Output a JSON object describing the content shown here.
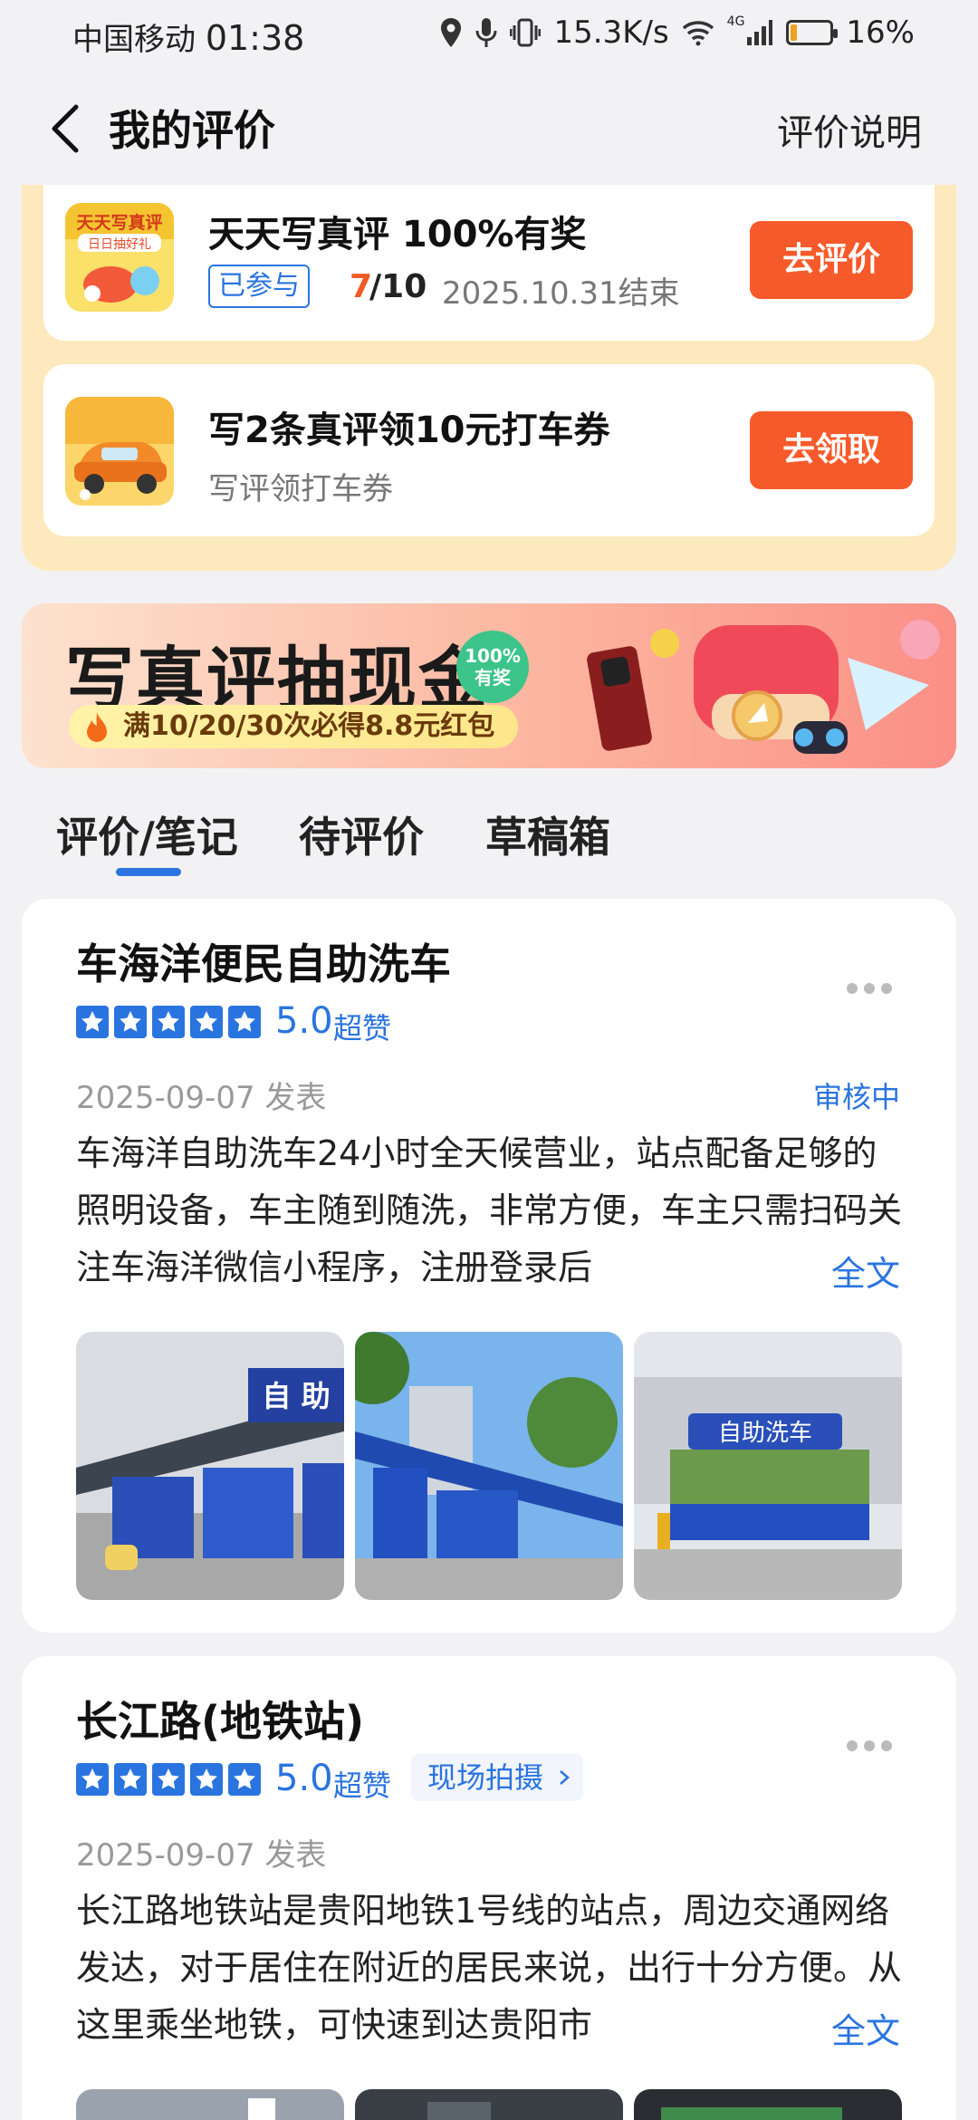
{
  "status_bar": {
    "carrier": "中国移动",
    "time": "01:38",
    "net_speed": "15.3K/s",
    "network": "4G",
    "battery": "16%",
    "battery_level": 0.16,
    "icons": [
      "location-icon",
      "mic-icon",
      "vibrate-icon",
      "wifi-icon",
      "signal-icon",
      "battery-icon"
    ]
  },
  "header": {
    "title": "我的评价",
    "help_link": "评价说明"
  },
  "promos": [
    {
      "title": "天天写真评 100%有奖",
      "badge": "已参与",
      "progress_done": "7",
      "progress_total": "/10",
      "deadline": "2025.10.31结束",
      "button": "去评价"
    },
    {
      "title": "写2条真评领10元打车券",
      "subtitle": "写评领打车券",
      "button": "去领取"
    }
  ],
  "banner": {
    "title": "写真评抽现金",
    "badge": "100% 有奖",
    "subtitle": "满10/20/30次必得8.8元红包"
  },
  "tabs": [
    {
      "label": "评价/笔记",
      "active": true
    },
    {
      "label": "待评价",
      "active": false
    },
    {
      "label": "草稿箱",
      "active": false
    }
  ],
  "reviews": [
    {
      "title": "车海洋便民自助洗车",
      "rating": "5.0",
      "rating_word": "超赞",
      "stars": 5,
      "date": "2025-09-07 发表",
      "status": "审核中",
      "body": "车海洋自助洗车24小时全天候营业，站点配备足够的照明设备，车主随到随洗，非常方便，车主只需扫码关注车海洋微信小程序，注册登录后",
      "full_text": "全文",
      "photos": [
        "photo-carwash-canopy",
        "photo-carwash-tower",
        "photo-carwash-gate"
      ]
    },
    {
      "title": "长江路(地铁站)",
      "rating": "5.0",
      "rating_word": "超赞",
      "stars": 5,
      "tag": "现场拍摄",
      "date": "2025-09-07 发表",
      "body": "长江路地铁站是贵阳地铁1号线的站点，周边交通网络发达，对于居住在附近的居民来说，出行十分方便。从这里乘坐地铁，可快速到达贵阳市",
      "full_text": "全文"
    }
  ],
  "colors": {
    "accent": "#2a74e0",
    "cta": "#f75a2a",
    "promo_bg": "#fde9bd"
  }
}
